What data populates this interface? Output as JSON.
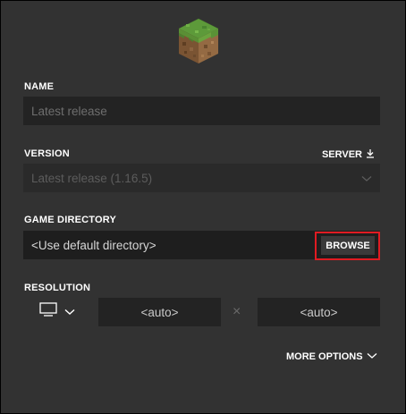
{
  "logo": {
    "icon": "grass-block-icon"
  },
  "name": {
    "label": "NAME",
    "placeholder": "Latest release",
    "value": ""
  },
  "version": {
    "label": "VERSION",
    "selected": "Latest release (1.16.5)",
    "server_label": "SERVER",
    "server_icon": "download-icon"
  },
  "game_directory": {
    "label": "GAME DIRECTORY",
    "value": "<Use default directory>",
    "browse_label": "BROWSE"
  },
  "resolution": {
    "label": "RESOLUTION",
    "monitor_icon": "monitor-icon",
    "width": "<auto>",
    "height": "<auto>",
    "separator": "×"
  },
  "more_options": {
    "label": "MORE OPTIONS"
  },
  "colors": {
    "background": "#323232",
    "input_background": "#232323",
    "highlight": "#e01b22",
    "text": "#ffffff"
  }
}
